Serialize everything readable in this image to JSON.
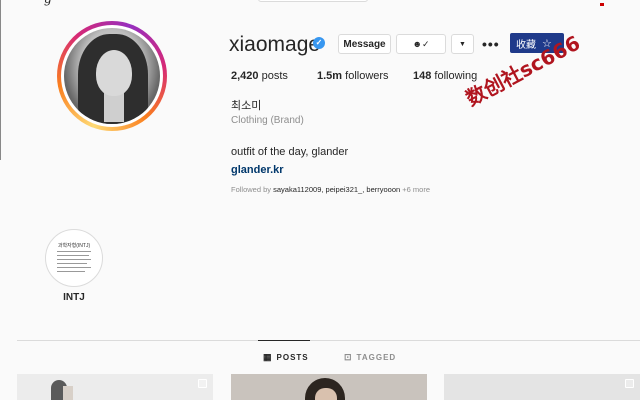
{
  "profile": {
    "username": "xiaomage",
    "verified_icon": "verified-badge-icon",
    "full_name": "최소미",
    "category": "Clothing (Brand)",
    "bio": "outfit of the day, glander",
    "website": "glander.kr"
  },
  "actions": {
    "message_label": "Message",
    "follow_icon": "person-check-icon",
    "dropdown_icon": "chevron-down-icon",
    "more_label": "•••"
  },
  "extension": {
    "label": "收藏",
    "icon": "star-icon"
  },
  "stats": {
    "posts_count": "2,420",
    "posts_label": "posts",
    "followers_count": "1.5m",
    "followers_label": "followers",
    "following_count": "148",
    "following_label": "following"
  },
  "followed_by": {
    "prefix": "Followed by",
    "users": "sayaka112009, peipei321_, berryooon",
    "more": "+6 more"
  },
  "highlights": [
    {
      "label": "INTJ",
      "cover_title": "과학자형(INTJ)"
    }
  ],
  "tabs": [
    {
      "label": "POSTS",
      "icon": "grid-icon",
      "active": true
    },
    {
      "label": "TAGGED",
      "icon": "tag-icon",
      "active": false
    }
  ],
  "watermark": "数创社sc666",
  "colors": {
    "verified": "#3897f0",
    "link": "#00376b",
    "extension_bg": "#1f3a8a",
    "watermark": "#b0151f"
  }
}
